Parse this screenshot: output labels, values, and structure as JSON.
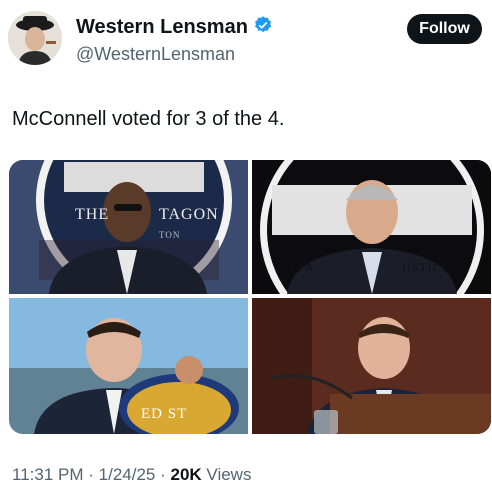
{
  "author": {
    "name": "Western Lensman",
    "handle": "@WesternLensman",
    "verified": true,
    "badge_color": "#1d9bf0"
  },
  "follow_label": "Follow",
  "tweet_text": "McConnell voted for 3 of the 4.",
  "images": [
    {
      "seal_text_left": "THE",
      "seal_text_right": "TAGON",
      "seal_text_small": "TON"
    },
    {
      "seal_text_left": "DEPA",
      "seal_text_right": "USTICE"
    },
    {
      "seal_text": "ED ST"
    },
    {}
  ],
  "meta": {
    "time": "11:31 PM",
    "date": "1/24/25",
    "views_count": "20K",
    "views_label": "Views"
  },
  "colors": {
    "text": "#0f1419",
    "secondary": "#536471",
    "button": "#0f1419"
  }
}
